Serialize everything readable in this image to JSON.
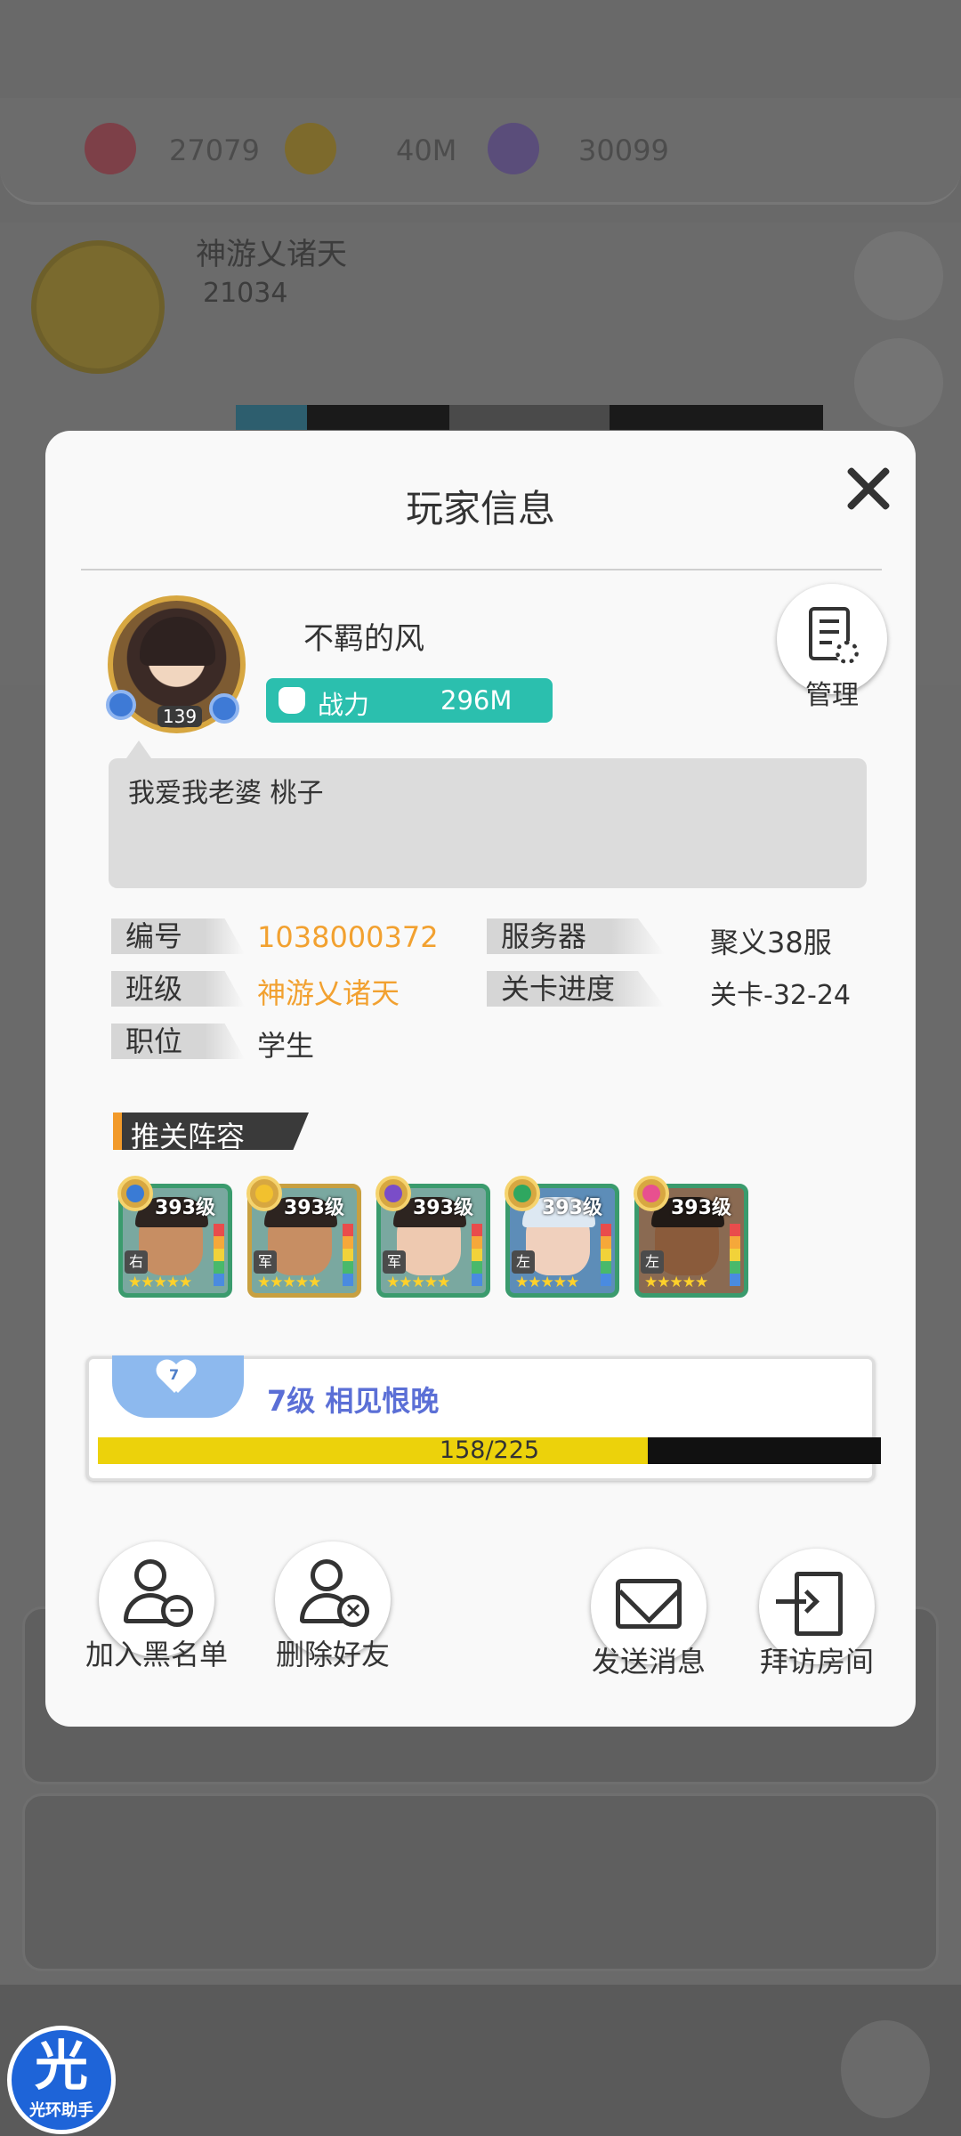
{
  "background": {
    "resources": [
      "27079",
      "40M",
      "30099"
    ],
    "guild_name": "神游乂诸天",
    "guild_id": "21034"
  },
  "dialog": {
    "title": "玩家信息"
  },
  "player": {
    "name": "不羁的风",
    "level": "139",
    "power_label": "战力",
    "power_value": "296M",
    "signature": "我爱我老婆 桃子",
    "manage_label": "管理"
  },
  "info": {
    "id_label": "编号",
    "id_value": "1038000372",
    "server_label": "服务器",
    "server_value": "聚义38服",
    "class_label": "班级",
    "class_value": "神游乂诸天",
    "stage_label": "关卡进度",
    "stage_value": "关卡-32-24",
    "position_label": "职位",
    "position_value": "学生"
  },
  "lineup": {
    "title": "推关阵容",
    "heroes": [
      {
        "level": "393级",
        "pos": "右",
        "element": "blue"
      },
      {
        "level": "393级",
        "pos": "军",
        "element": "gold"
      },
      {
        "level": "393级",
        "pos": "军",
        "element": "purple"
      },
      {
        "level": "393级",
        "pos": "左",
        "element": "green"
      },
      {
        "level": "393级",
        "pos": "左",
        "element": "pink"
      }
    ]
  },
  "intimacy": {
    "heart_level": "7",
    "label": "7级 相见恨晚",
    "progress_text": "158/225",
    "current": 158,
    "max": 225
  },
  "actions": {
    "blacklist": "加入黑名单",
    "delete_friend": "删除好友",
    "send_message": "发送消息",
    "visit_room": "拜访房间"
  },
  "watermark": {
    "glyph": "光",
    "text": "光环助手"
  },
  "colors": {
    "accent_orange": "#f2a130",
    "power_teal": "#2bbfae",
    "intimacy_bar": "#ecd20b",
    "intimacy_text": "#5b6fd6"
  }
}
